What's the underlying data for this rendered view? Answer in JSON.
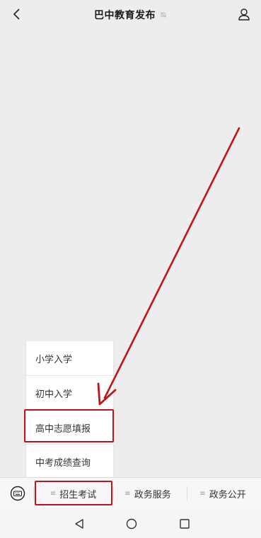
{
  "header": {
    "title": "巴中教育发布",
    "back_icon": "chevron-left-icon",
    "mute_icon": "bell-muted-icon",
    "profile_icon": "person-icon"
  },
  "submenu": {
    "items": [
      {
        "label": "小学入学"
      },
      {
        "label": "初中入学"
      },
      {
        "label": "高中志愿填报",
        "highlighted": true
      },
      {
        "label": "中考成绩查询"
      }
    ]
  },
  "menubar": {
    "keyboard_icon": "keyboard-icon",
    "items": [
      {
        "label": "招生考试",
        "highlighted": true
      },
      {
        "label": "政务服务"
      },
      {
        "label": "政务公开"
      }
    ]
  },
  "system_nav": {
    "back": "triangle-back-icon",
    "home": "circle-home-icon",
    "recents": "square-recents-icon"
  },
  "annotation": {
    "arrow_color": "#c0141b",
    "highlight_color": "#c0141b"
  }
}
